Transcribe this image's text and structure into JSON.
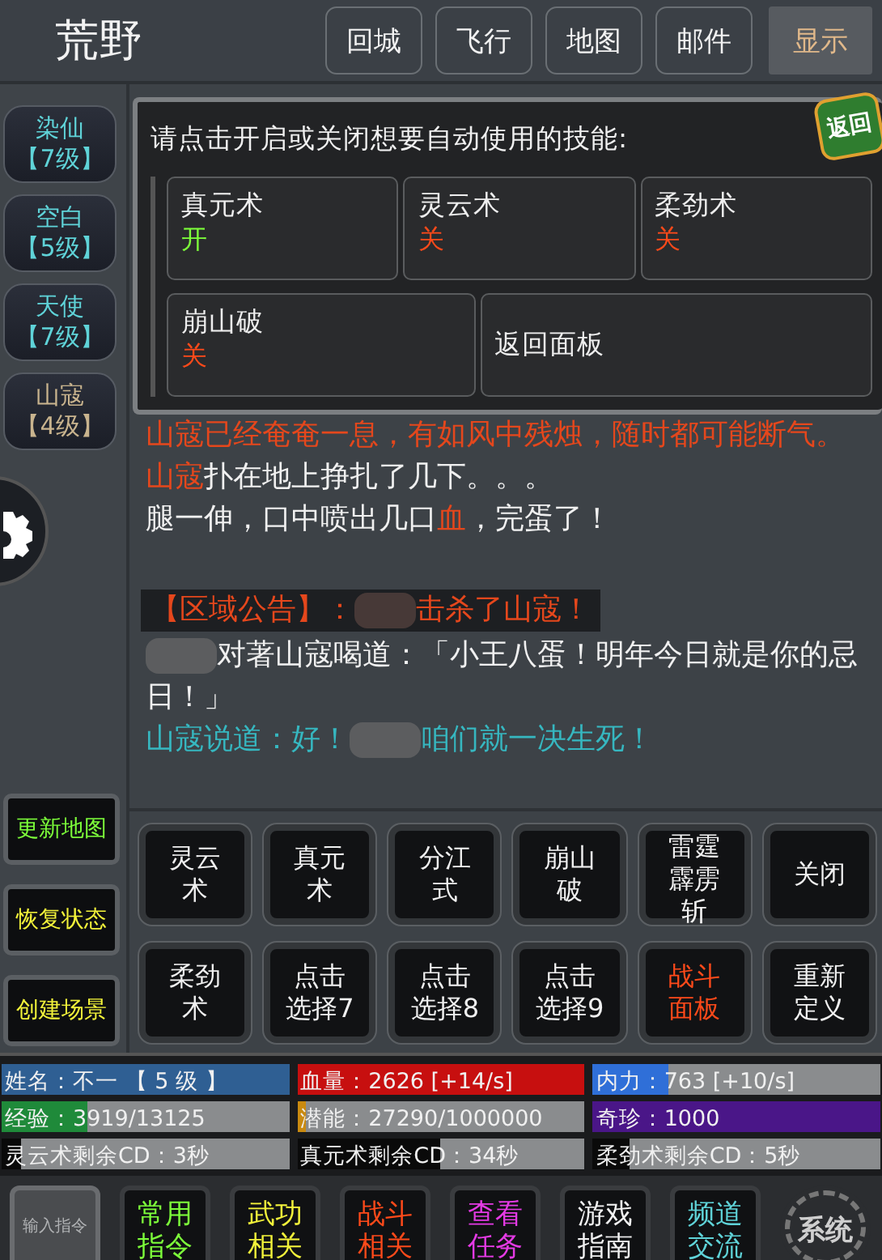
{
  "header": {
    "title": "荒野",
    "buttons": [
      {
        "label": "回城",
        "kind": "outline"
      },
      {
        "label": "飞行",
        "kind": "outline"
      },
      {
        "label": "地图",
        "kind": "outline"
      },
      {
        "label": "邮件",
        "kind": "outline"
      },
      {
        "label": "显示",
        "kind": "filled"
      }
    ]
  },
  "npcs": [
    {
      "name": "染仙",
      "level": "【7级】",
      "color": "#5fd3d8"
    },
    {
      "name": "空白",
      "level": "【5级】",
      "color": "#5fd3d8"
    },
    {
      "name": "天使",
      "level": "【7级】",
      "color": "#5fd3d8"
    },
    {
      "name": "山寇",
      "level": "【4级】",
      "color": "#c9b48e"
    }
  ],
  "side_actions": [
    {
      "label": "更新地图",
      "kind": "refresh"
    },
    {
      "label": "恢复状态",
      "kind": "action"
    },
    {
      "label": "创建场景",
      "kind": "action"
    }
  ],
  "skill_panel": {
    "prompt": "请点击开启或关闭想要自动使用的技能:",
    "badge": "返回",
    "skills": [
      {
        "name": "真元术",
        "on": true,
        "state_label": "开"
      },
      {
        "name": "灵云术",
        "on": false,
        "state_label": "关"
      },
      {
        "name": "柔劲术",
        "on": false,
        "state_label": "关"
      },
      {
        "name": "崩山破",
        "on": false,
        "state_label": "关"
      }
    ],
    "back_button": "返回面板"
  },
  "log": [
    {
      "kind": "plain",
      "segments": [
        {
          "text": "山寇已经奄奄一息，有如风中残烛，随时都可能断气。",
          "kind": "enemy"
        }
      ]
    },
    {
      "kind": "plain",
      "segments": [
        {
          "text": "山寇",
          "kind": "enemy"
        },
        {
          "text": "扑在地上挣扎了几下。。。",
          "kind": "normal"
        }
      ]
    },
    {
      "kind": "plain",
      "segments": [
        {
          "text": "腿一伸，口中喷出几口",
          "kind": "normal"
        },
        {
          "text": "血",
          "kind": "enemy"
        },
        {
          "text": "，完蛋了！",
          "kind": "normal"
        }
      ]
    },
    {
      "kind": "notice",
      "segments": [
        {
          "text": "【区域公告】：",
          "kind": "enemy"
        },
        {
          "kind": "blur"
        },
        {
          "text": "击杀了山寇！",
          "kind": "enemy"
        }
      ]
    },
    {
      "kind": "plain",
      "segments": [
        {
          "kind": "blur"
        },
        {
          "text": "对著山寇喝道：「小王八蛋！明年今日就是你的忌日！」",
          "kind": "normal"
        }
      ]
    },
    {
      "kind": "plain",
      "segments": [
        {
          "text": "山寇说道：好！",
          "kind": "speech"
        },
        {
          "kind": "blur"
        },
        {
          "text": "咱们就一决生死！",
          "kind": "speech"
        }
      ]
    }
  ],
  "skill_buttons": [
    {
      "label": "灵云术",
      "selected": false
    },
    {
      "label": "真元术",
      "selected": false
    },
    {
      "label": "分江式",
      "selected": false
    },
    {
      "label": "崩山破",
      "selected": false
    },
    {
      "label": "雷霆霹雳斩",
      "selected": false
    },
    {
      "label": "关闭",
      "selected": false
    },
    {
      "label": "柔劲术",
      "selected": false
    },
    {
      "label": "点击选择7",
      "selected": false
    },
    {
      "label": "点击选择8",
      "selected": false
    },
    {
      "label": "点击选择9",
      "selected": false
    },
    {
      "label": "战斗面板",
      "selected": true
    },
    {
      "label": "重新定义",
      "selected": false
    }
  ],
  "stats": [
    {
      "text": "姓名：不一 【 5 级 】",
      "level": 1,
      "color": "#2f5f93"
    },
    {
      "text": "血量：2626 [+14/s]",
      "level": 1,
      "color": "#c70f0f"
    },
    {
      "text": "内力：763 [+10/s]",
      "level": 0.26,
      "color": "#2f6fd8"
    },
    {
      "text": "经验：3919/13125",
      "level": 0.3,
      "color": "#1f8a3a"
    },
    {
      "text": "潜能：27290/1000000",
      "level": 0.03,
      "color": "#c98a10"
    },
    {
      "text": "奇珍：1000",
      "level": 1,
      "color": "#4a1688"
    },
    {
      "text": "灵云术剩余CD：3秒",
      "level": 0.07,
      "color": "#0a0a0a"
    },
    {
      "text": "真元术剩余CD：34秒",
      "level": 0.5,
      "color": "#0a0a0a"
    },
    {
      "text": "柔劲术剩余CD：5秒",
      "level": 0.13,
      "color": "#0a0a0a"
    }
  ],
  "toolbar": [
    {
      "label": "输入指令",
      "kind": "input"
    },
    {
      "label": "常用指令",
      "kind": "menu",
      "color": "#7dff3a"
    },
    {
      "label": "武功相关",
      "kind": "menu",
      "color": "#f2f23a"
    },
    {
      "label": "战斗相关",
      "kind": "menu",
      "color": "#ff4a1a"
    },
    {
      "label": "查看任务",
      "kind": "menu",
      "color": "#e43ae4"
    },
    {
      "label": "游戏指南",
      "kind": "menu",
      "color": "#f2f2f2"
    },
    {
      "label": "频道交流",
      "kind": "menu",
      "color": "#5fd3d8"
    },
    {
      "label": "系统",
      "kind": "system"
    }
  ]
}
